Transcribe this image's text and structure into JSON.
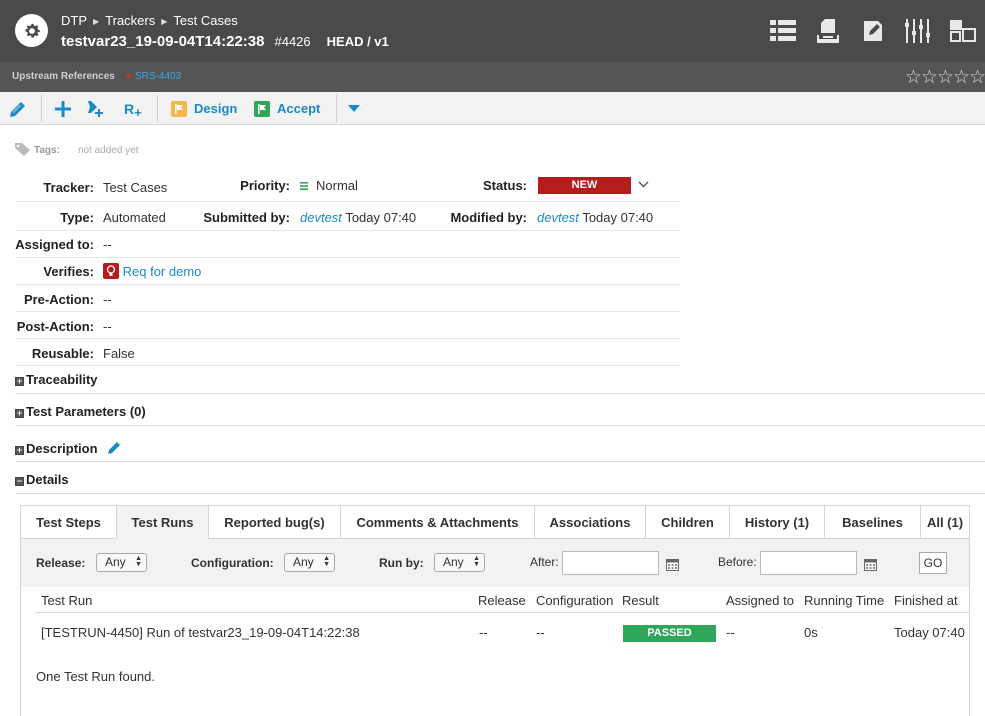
{
  "header": {
    "breadcrumb": [
      "DTP",
      "Trackers",
      "Test Cases"
    ],
    "title": "testvar23_19-09-04T14:22:38",
    "item_number": "#4426",
    "version": "HEAD / v1",
    "icons": [
      "list-view-icon",
      "document-icon",
      "edit-doc-icon",
      "columns-icon",
      "layout-icon"
    ]
  },
  "references": {
    "label": "Upstream References",
    "ref": "SRS-4403",
    "stars": "☆☆☆☆☆"
  },
  "toolbar": {
    "design_label": "Design",
    "accept_label": "Accept",
    "add_r": "R"
  },
  "tags": {
    "label": "Tags:",
    "value": "not added yet"
  },
  "properties": {
    "tracker_label": "Tracker:",
    "tracker": "Test Cases",
    "priority_label": "Priority:",
    "priority": "Normal",
    "status_label": "Status:",
    "status": "NEW",
    "type_label": "Type:",
    "type": "Automated",
    "submitted_label": "Submitted by:",
    "submitted_user": "devtest",
    "submitted_time": "Today 07:40",
    "modified_label": "Modified by:",
    "modified_user": "devtest",
    "modified_time": "Today 07:40",
    "assigned_label": "Assigned to:",
    "assigned": "--",
    "verifies_label": "Verifies:",
    "verifies": "Req for demo",
    "preaction_label": "Pre-Action:",
    "preaction": "--",
    "postaction_label": "Post-Action:",
    "postaction": "--",
    "reusable_label": "Reusable:",
    "reusable": "False"
  },
  "sections": {
    "traceability": "Traceability",
    "parameters": "Test Parameters (0)",
    "description": "Description",
    "details": "Details"
  },
  "tabs": [
    "Test Steps",
    "Test Runs",
    "Reported bug(s)",
    "Comments & Attachments",
    "Associations",
    "Children",
    "History (1)",
    "Baselines",
    "All (1)"
  ],
  "filters": {
    "release_label": "Release:",
    "release_value": "Any",
    "config_label": "Configuration:",
    "config_value": "Any",
    "runby_label": "Run by:",
    "runby_value": "Any",
    "after_label": "After:",
    "before_label": "Before:",
    "go_label": "GO"
  },
  "table": {
    "columns": [
      "Test Run",
      "Release",
      "Configuration",
      "Result",
      "Assigned to",
      "Running Time",
      "Finished at"
    ],
    "rows": [
      {
        "test_run": "[TESTRUN-4450] Run of testvar23_19-09-04T14:22:38",
        "release": "--",
        "configuration": "--",
        "result": "PASSED",
        "assigned_to": "--",
        "running_time": "0s",
        "finished_at": "Today 07:40"
      }
    ],
    "footer": "One Test Run found."
  },
  "colors": {
    "header_bg": "#4a4a4a",
    "link": "#1a8ac5",
    "status_new": "#b71c1c",
    "passed": "#2fa65a"
  }
}
